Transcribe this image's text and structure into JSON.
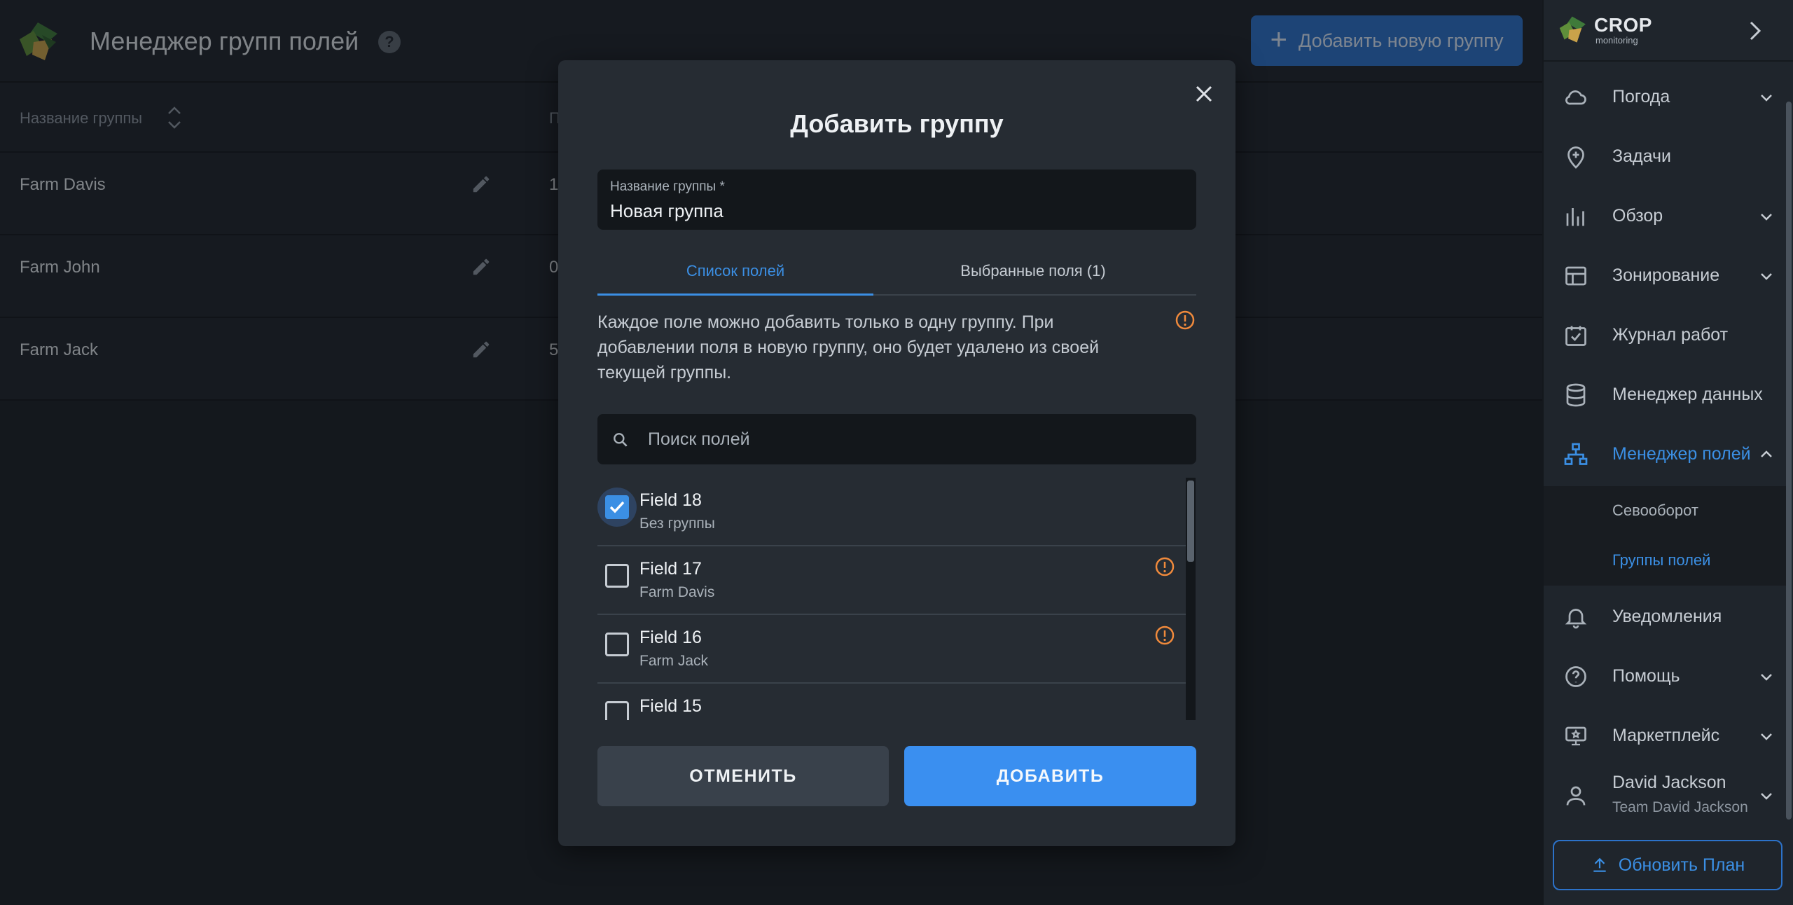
{
  "header": {
    "title": "Менеджер групп полей",
    "help_icon": "question-icon",
    "add_group_label": "Добавить новую группу"
  },
  "table": {
    "col_group_name": "Название группы",
    "col_second": "П",
    "rows": [
      {
        "name": "Farm Davis",
        "count": "1"
      },
      {
        "name": "Farm John",
        "count": "0"
      },
      {
        "name": "Farm Jack",
        "count": "5"
      }
    ]
  },
  "sidebar": {
    "brand": "CROP",
    "brand_sub": "monitoring",
    "items": [
      {
        "label": "Погода",
        "icon": "cloud-icon"
      },
      {
        "label": "Задачи",
        "icon": "map-pin-plus-icon"
      },
      {
        "label": "Обзор",
        "icon": "bar-chart-icon"
      },
      {
        "label": "Зонирование",
        "icon": "layout-icon"
      },
      {
        "label": "Журнал работ",
        "icon": "calendar-check-icon"
      },
      {
        "label": "Менеджер данных",
        "icon": "database-icon"
      },
      {
        "label": "Менеджер полей",
        "icon": "hierarchy-icon"
      },
      {
        "label": "Уведомления",
        "icon": "bell-icon"
      },
      {
        "label": "Помощь",
        "icon": "help-circle-icon"
      },
      {
        "label": "Маркетплейс",
        "icon": "monitor-star-icon"
      }
    ],
    "sub_items": [
      {
        "label": "Севооборот"
      },
      {
        "label": "Группы полей"
      }
    ],
    "user": {
      "name": "David Jackson",
      "team": "Team David Jackson"
    },
    "upgrade_label": "Обновить План"
  },
  "modal": {
    "title": "Добавить группу",
    "name_label": "Название группы *",
    "name_value": "Новая группа",
    "tab_fields": "Список полей",
    "tab_selected": "Выбранные поля (1)",
    "info": "Каждое поле можно добавить только в одну группу. При добавлении поля в новую группу, оно будет удалено из своей текущей группы.",
    "search_placeholder": "Поиск полей",
    "fields": [
      {
        "name": "Field 18",
        "group": "Без группы",
        "checked": true,
        "warning": false
      },
      {
        "name": "Field 17",
        "group": "Farm Davis",
        "checked": false,
        "warning": true
      },
      {
        "name": "Field 16",
        "group": "Farm Jack",
        "checked": false,
        "warning": true
      },
      {
        "name": "Field 15",
        "group": "",
        "checked": false,
        "warning": false
      }
    ],
    "cancel_label": "ОТМЕНИТЬ",
    "add_label": "ДОБАВИТЬ"
  },
  "colors": {
    "accent": "#3b8fe4",
    "primary_button": "#3a8ff0",
    "warning": "#f08a3c",
    "background": "#1c2127"
  }
}
